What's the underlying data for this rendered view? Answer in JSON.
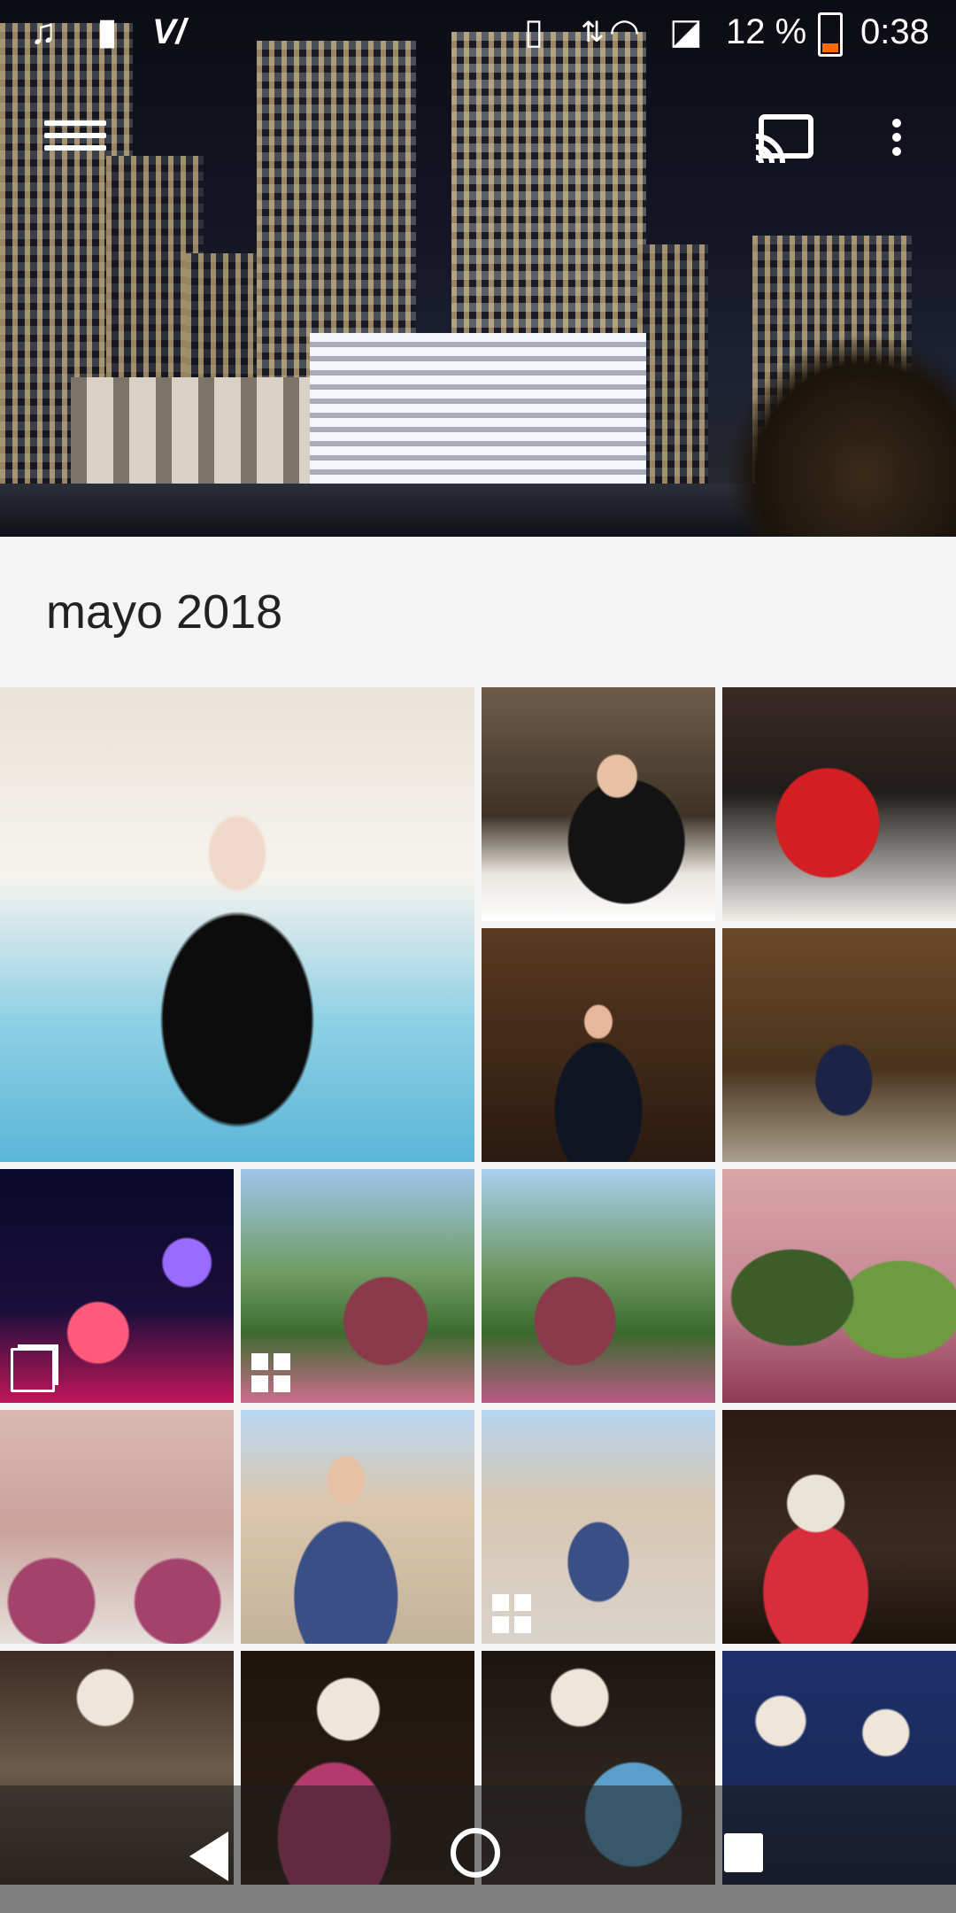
{
  "status_bar": {
    "battery_text": "12 %",
    "time": "0:38",
    "icons": [
      "music-note-icon",
      "battery-alert-icon",
      "carrier-icon",
      "vibrate-icon",
      "data-arrows-icon",
      "wifi-icon",
      "no-sim-icon",
      "battery-icon"
    ]
  },
  "top_bar": {
    "menu_icon": "menu-icon",
    "cast_icon": "cast-icon",
    "more_icon": "more-vert-icon"
  },
  "section": {
    "title": "mayo 2018"
  },
  "photos": [
    {
      "name": "photo-woman-pool-fountain",
      "badge": ""
    },
    {
      "name": "photo-woman-dinner-table",
      "badge": ""
    },
    {
      "name": "photo-red-dessert",
      "badge": ""
    },
    {
      "name": "photo-woman-dining-hall",
      "badge": ""
    },
    {
      "name": "photo-woman-blue-dress-hall",
      "badge": ""
    },
    {
      "name": "photo-topiary-mushrooms",
      "badge": "burst-icon"
    },
    {
      "name": "photo-woman-floral-dress-lake",
      "badge": "collage-icon"
    },
    {
      "name": "photo-woman-floral-dress-trees",
      "badge": ""
    },
    {
      "name": "photo-topiary-dogs",
      "badge": ""
    },
    {
      "name": "photo-venetian-lamp",
      "badge": ""
    },
    {
      "name": "photo-woman-plaza",
      "badge": ""
    },
    {
      "name": "photo-woman-plaza-wide",
      "badge": "collage-icon"
    },
    {
      "name": "photo-catrina-figure",
      "badge": ""
    },
    {
      "name": "photo-skeleton-bride",
      "badge": ""
    },
    {
      "name": "photo-catrina-dancer",
      "badge": ""
    },
    {
      "name": "photo-skeleton-couple",
      "badge": ""
    },
    {
      "name": "photo-skeleton-mariachis",
      "badge": ""
    }
  ],
  "nav_bar": {
    "back": "back-icon",
    "home": "home-icon",
    "recents": "recents-icon"
  }
}
